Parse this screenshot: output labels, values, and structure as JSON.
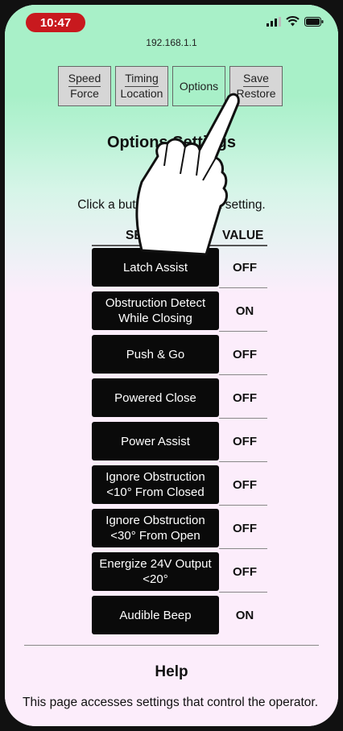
{
  "status_bar": {
    "time": "10:47"
  },
  "browser": {
    "url": "192.168.1.1"
  },
  "tabs": [
    {
      "line1": "Speed",
      "line2": "Force"
    },
    {
      "line1": "Timing",
      "line2": "Location"
    },
    {
      "label": "Options"
    },
    {
      "line1": "Save",
      "line2": "Restore"
    }
  ],
  "page": {
    "title": "Options Settings",
    "instruction": "Click a button to change a setting."
  },
  "table": {
    "headers": {
      "setting": "SETTING",
      "value": "VALUE"
    },
    "rows": [
      {
        "setting": "Latch Assist",
        "value": "OFF"
      },
      {
        "setting": "Obstruction Detect While Closing",
        "value": "ON"
      },
      {
        "setting": "Push & Go",
        "value": "OFF"
      },
      {
        "setting": "Powered Close",
        "value": "OFF"
      },
      {
        "setting": "Power Assist",
        "value": "OFF"
      },
      {
        "setting": "Ignore Obstruction <10° From Closed",
        "value": "OFF"
      },
      {
        "setting": "Ignore Obstruction <30° From Open",
        "value": "OFF"
      },
      {
        "setting": "Energize 24V Output <20°",
        "value": "OFF"
      },
      {
        "setting": "Audible Beep",
        "value": "ON"
      }
    ]
  },
  "help": {
    "title": "Help",
    "text": "This page accesses settings that control the operator."
  },
  "icons": [
    "signal-icon",
    "wifi-icon",
    "battery-icon",
    "hand-pointer-icon"
  ],
  "colors": {
    "accent_green": "#a8f0c8",
    "page_pink": "#fcedfb",
    "time_pill": "#c8191e",
    "button": "#0a0a0a"
  }
}
